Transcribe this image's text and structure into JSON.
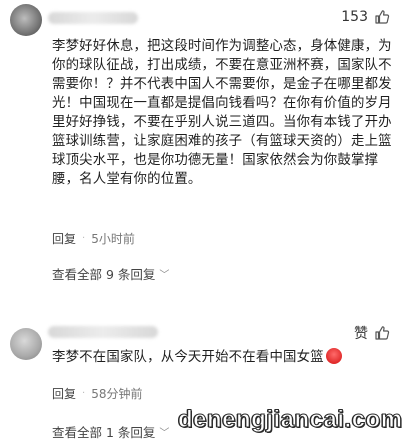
{
  "comments": [
    {
      "like_count": "153",
      "text": "李梦好好休息，把这段时间作为调整心态，身体健康，为你的球队征战，打出成绩，不要在意亚洲杯赛，国家队不需要你！？并不代表中国人不需要你，是金子在哪里都发光！中国现在一直都是提倡向钱看吗？在你有价值的岁月里好好挣钱，不要在乎别人说三道四。当你有本钱了开办篮球训练营，让家庭困难的孩子（有篮球天资的）走上篮球顶尖水平，也是你功德无量！国家依然会为你鼓掌撑腰，名人堂有你的位置。",
      "reply_label": "回复",
      "time": "5小时前",
      "view_all": "查看全部 9 条回复"
    },
    {
      "like_label": "赞",
      "text": "李梦不在国家队，从今天开始不在看中国女篮",
      "reply_label": "回复",
      "time": "58分钟前",
      "view_all": "查看全部 1 条回复"
    }
  ],
  "watermark": "denengjiancai.com",
  "icons": {
    "like": "thumbs-up-icon",
    "chevron": "chevron-down-icon",
    "emoji": "angry-face-emoji-icon"
  }
}
